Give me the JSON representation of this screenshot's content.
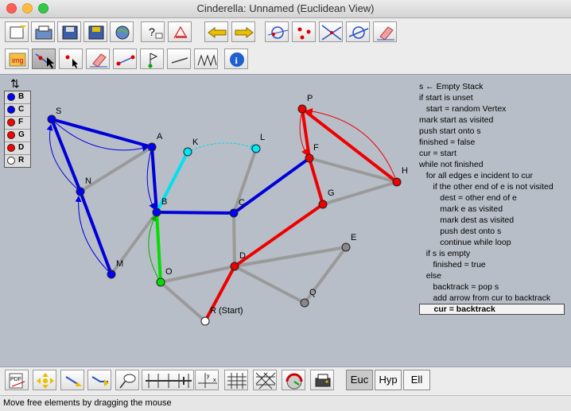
{
  "window": {
    "title": "Cinderella: Unnamed (Euclidean View)"
  },
  "toolbar_top": {
    "buttons": [
      "new-file-icon",
      "open-file-icon",
      "save-file-icon",
      "save-as-icon",
      "globe-icon",
      "help-icon",
      "construct-icon",
      "undo-arrow-icon",
      "redo-arrow-icon",
      "circle-mode-icon",
      "points-mode-icon",
      "lines-mode-icon",
      "circle-line-icon",
      "eraser-icon"
    ]
  },
  "toolbar_second": {
    "buttons": [
      "image-tool-icon",
      "move-tool-icon",
      "add-point-icon",
      "eraser-tool-icon",
      "segment-tool-icon",
      "flag-tool-icon",
      "line-tool-icon",
      "zigzag-tool-icon",
      "info-icon"
    ]
  },
  "legend": {
    "swap_label": "⇅",
    "items": [
      {
        "label": "B",
        "color": "#0000ff"
      },
      {
        "label": "C",
        "color": "#0000ff"
      },
      {
        "label": "F",
        "color": "#ff0000"
      },
      {
        "label": "G",
        "color": "#ff0000"
      },
      {
        "label": "D",
        "color": "#ff0000"
      },
      {
        "label": "R",
        "color": "#ffffff"
      }
    ]
  },
  "algorithm": [
    "s ← Empty Stack",
    "if start is unset",
    "   start = random Vertex",
    "mark start as visited",
    "push start onto s",
    "finished = false",
    "cur = start",
    "while not finished",
    "   for all edges e incident to cur",
    "      if the other end of e is not visited",
    "         dest = other end of e",
    "         mark e as visited",
    "         mark dest as visited",
    "         push dest onto s",
    "         continue while loop",
    "   if s is empty",
    "      finished = true",
    "   else",
    "      backtrack = pop s",
    "      add arrow from cur to backtrack",
    "      cur = backtrack"
  ],
  "vertices": {
    "S": "S",
    "A": "A",
    "N": "N",
    "B": "B",
    "M": "M",
    "K": "K",
    "L": "L",
    "C": "C",
    "O": "O",
    "D": "D",
    "R": "R (Start)",
    "E": "E",
    "Q": "Q",
    "P": "P",
    "F": "F",
    "G": "G",
    "H": "H"
  },
  "bottom_toolbar": {
    "buttons": [
      "pdf-export-icon",
      "move-view-icon",
      "zoom-icon",
      "translate-icon",
      "butterfly-net-icon",
      "grid-icon",
      "axes-icon",
      "fine-grid-icon",
      "triangle-grid-icon",
      "gauge-icon",
      "print-icon"
    ],
    "geometry_modes": [
      {
        "label": "Euc",
        "selected": true
      },
      {
        "label": "Hyp",
        "selected": false
      },
      {
        "label": "Ell",
        "selected": false
      }
    ]
  },
  "status": {
    "text": "Move free elements by dragging the mouse"
  }
}
